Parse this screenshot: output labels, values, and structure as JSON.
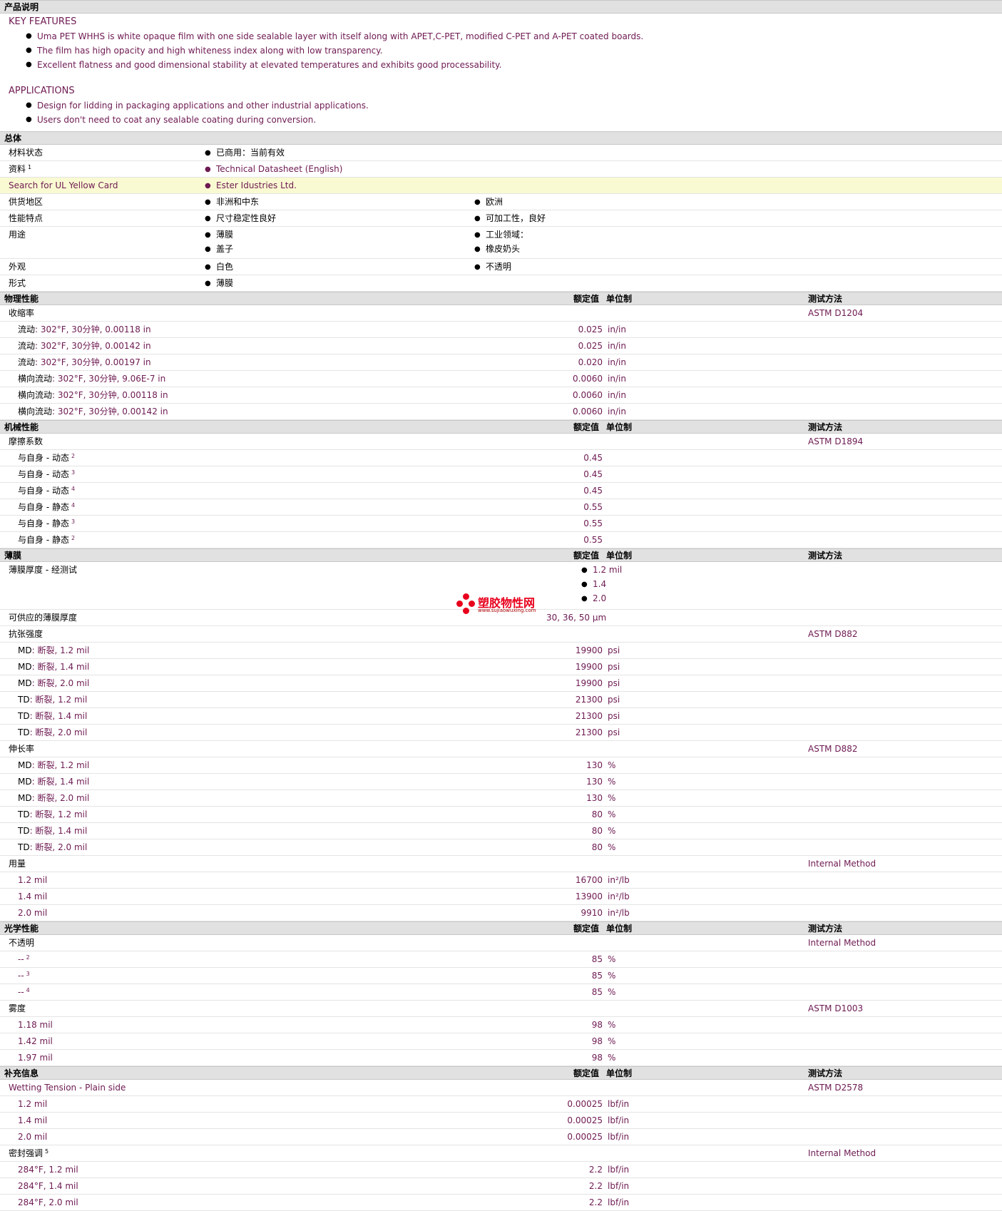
{
  "sections": {
    "desc": "产品说明",
    "general": "总体",
    "physical": "物理性能",
    "mechanical": "机械性能",
    "film": "薄膜",
    "optical": "光学性能",
    "additional": "补充信息"
  },
  "cols": {
    "value": "额定值",
    "unit": "单位制",
    "method": "测试方法"
  },
  "description": {
    "features_head": "KEY FEATURES",
    "features": [
      "Uma PET WHHS is white opaque film with one side sealable layer with itself along with APET,C-PET, modified C-PET and A-PET coated boards.",
      "The film has high opacity and high whiteness index along with low transparency.",
      "Excellent flatness and good dimensional stability at elevated temperatures and exhibits good processability."
    ],
    "apps_head": "APPLICATIONS",
    "apps": [
      "Design for lidding in packaging applications and other industrial applications.",
      "Users don't need to coat any sealable coating during conversion."
    ]
  },
  "general": {
    "status_label": "材料状态",
    "status": "已商用：当前有效",
    "docs_label": "资料",
    "docs_sup": "1",
    "docs": "Technical Datasheet (English)",
    "ul_label": "Search for UL Yellow Card",
    "ul": "Ester Idustries Ltd.",
    "region_label": "供货地区",
    "region1": "非洲和中东",
    "region2": "欧洲",
    "feat_label": "性能特点",
    "feat1": "尺寸稳定性良好",
    "feat2": "可加工性，良好",
    "use_label": "用途",
    "use1": "薄膜",
    "use2": "工业领域：",
    "use3": "盖子",
    "use4": "橡皮奶头",
    "appear_label": "外观",
    "appear1": "白色",
    "appear2": "不透明",
    "form_label": "形式",
    "form1": "薄膜"
  },
  "physical": {
    "shrink_label": "收缩率",
    "shrink_method": "ASTM D1204",
    "rows": [
      {
        "k": "流动",
        "d": ": 302°F, 30分钟, 0.00118 in",
        "v": "0.025",
        "u": "in/in"
      },
      {
        "k": "流动",
        "d": ": 302°F, 30分钟, 0.00142 in",
        "v": "0.025",
        "u": "in/in"
      },
      {
        "k": "流动",
        "d": ": 302°F, 30分钟, 0.00197 in",
        "v": "0.020",
        "u": "in/in"
      },
      {
        "k": "横向流动",
        "d": ": 302°F, 30分钟, 9.06E-7 in",
        "v": "0.0060",
        "u": "in/in"
      },
      {
        "k": "横向流动",
        "d": ": 302°F, 30分钟, 0.00118 in",
        "v": "0.0060",
        "u": "in/in"
      },
      {
        "k": "横向流动",
        "d": ": 302°F, 30分钟, 0.00142 in",
        "v": "0.0060",
        "u": "in/in"
      }
    ]
  },
  "mechanical": {
    "cof_label": "摩擦系数",
    "cof_method": "ASTM D1894",
    "rows": [
      {
        "k": "与自身",
        "d": " - 动态",
        "s": "2",
        "v": "0.45"
      },
      {
        "k": "与自身",
        "d": " - 动态",
        "s": "3",
        "v": "0.45"
      },
      {
        "k": "与自身",
        "d": " - 动态",
        "s": "4",
        "v": "0.45"
      },
      {
        "k": "与自身",
        "d": " - 静态",
        "s": "4",
        "v": "0.55"
      },
      {
        "k": "与自身",
        "d": " - 静态",
        "s": "3",
        "v": "0.55"
      },
      {
        "k": "与自身",
        "d": " - 静态",
        "s": "2",
        "v": "0.55"
      }
    ]
  },
  "film": {
    "thick_label": "薄膜厚度",
    "thick_sub": " - 经测试",
    "thick": [
      "1.2 mil",
      "1.4",
      "2.0"
    ],
    "avail_label": "可供应的薄膜厚度",
    "avail": "30, 36, 50 µm",
    "tensile_label": "抗张强度",
    "tensile_method": "ASTM D882",
    "tensile": [
      {
        "k": "MD",
        "d": ": 断裂, 1.2 mil",
        "v": "19900",
        "u": "psi"
      },
      {
        "k": "MD",
        "d": ": 断裂, 1.4 mil",
        "v": "19900",
        "u": "psi"
      },
      {
        "k": "MD",
        "d": ": 断裂, 2.0 mil",
        "v": "19900",
        "u": "psi"
      },
      {
        "k": "TD",
        "d": ": 断裂, 1.2 mil",
        "v": "21300",
        "u": "psi"
      },
      {
        "k": "TD",
        "d": ": 断裂, 1.4 mil",
        "v": "21300",
        "u": "psi"
      },
      {
        "k": "TD",
        "d": ": 断裂, 2.0 mil",
        "v": "21300",
        "u": "psi"
      }
    ],
    "elong_label": "伸长率",
    "elong_method": "ASTM D882",
    "elong": [
      {
        "k": "MD",
        "d": ": 断裂, 1.2 mil",
        "v": "130",
        "u": "%"
      },
      {
        "k": "MD",
        "d": ": 断裂, 1.4 mil",
        "v": "130",
        "u": "%"
      },
      {
        "k": "MD",
        "d": ": 断裂, 2.0 mil",
        "v": "130",
        "u": "%"
      },
      {
        "k": "TD",
        "d": ": 断裂, 1.2 mil",
        "v": "80",
        "u": "%"
      },
      {
        "k": "TD",
        "d": ": 断裂, 1.4 mil",
        "v": "80",
        "u": "%"
      },
      {
        "k": "TD",
        "d": ": 断裂, 2.0 mil",
        "v": "80",
        "u": "%"
      }
    ],
    "yield_label": "用量",
    "yield_method": "Internal Method",
    "yield": [
      {
        "d": "1.2 mil",
        "v": "16700",
        "u": "in²/lb"
      },
      {
        "d": "1.4 mil",
        "v": "13900",
        "u": "in²/lb"
      },
      {
        "d": "2.0 mil",
        "v": "9910",
        "u": "in²/lb"
      }
    ]
  },
  "optical": {
    "opac_label": "不透明",
    "opac_method": "Internal Method",
    "opac": [
      {
        "d": "--",
        "s": "2",
        "v": "85",
        "u": "%"
      },
      {
        "d": "--",
        "s": "3",
        "v": "85",
        "u": "%"
      },
      {
        "d": "--",
        "s": "4",
        "v": "85",
        "u": "%"
      }
    ],
    "haze_label": "雾度",
    "haze_method": "ASTM D1003",
    "haze": [
      {
        "d": "1.18 mil",
        "v": "98",
        "u": "%"
      },
      {
        "d": "1.42 mil",
        "v": "98",
        "u": "%"
      },
      {
        "d": "1.97 mil",
        "v": "98",
        "u": "%"
      }
    ]
  },
  "additional": {
    "wet_label": "Wetting Tension - Plain side",
    "wet_method": "ASTM D2578",
    "wet": [
      {
        "d": "1.2 mil",
        "v": "0.00025",
        "u": "lbf/in"
      },
      {
        "d": "1.4 mil",
        "v": "0.00025",
        "u": "lbf/in"
      },
      {
        "d": "2.0 mil",
        "v": "0.00025",
        "u": "lbf/in"
      }
    ],
    "seal_label": "密封强调",
    "seal_sup": "5",
    "seal_method": "Internal Method",
    "seal": [
      {
        "d": "284°F, 1.2 mil",
        "v": "2.2",
        "u": "lbf/in"
      },
      {
        "d": "284°F, 1.4 mil",
        "v": "2.2",
        "u": "lbf/in"
      },
      {
        "d": "284°F, 2.0 mil",
        "v": "2.2",
        "u": "lbf/in"
      }
    ]
  },
  "watermark": {
    "cn": "塑胶物性网",
    "url": "www.sujiaowuxing.com"
  }
}
